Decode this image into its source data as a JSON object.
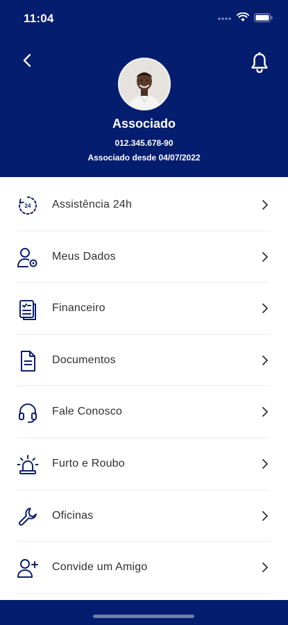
{
  "status_bar": {
    "time": "11:04"
  },
  "profile": {
    "name": "Associado",
    "id": "012.345.678-90",
    "since": "Associado desde 04/07/2022"
  },
  "menu": {
    "items": [
      {
        "label": "Assistência 24h",
        "icon": "clock-24h-icon"
      },
      {
        "label": "Meus Dados",
        "icon": "user-settings-icon"
      },
      {
        "label": "Financeiro",
        "icon": "clipboard-checklist-icon"
      },
      {
        "label": "Documentos",
        "icon": "document-icon"
      },
      {
        "label": "Fale Conosco",
        "icon": "headset-icon"
      },
      {
        "label": "Furto e Roubo",
        "icon": "alarm-siren-icon"
      },
      {
        "label": "Oficinas",
        "icon": "wrench-icon"
      },
      {
        "label": "Convide um Amigo",
        "icon": "user-plus-icon"
      }
    ]
  },
  "colors": {
    "header": "#051d6e",
    "icon": "#0a1e6e",
    "text": "#303030"
  }
}
